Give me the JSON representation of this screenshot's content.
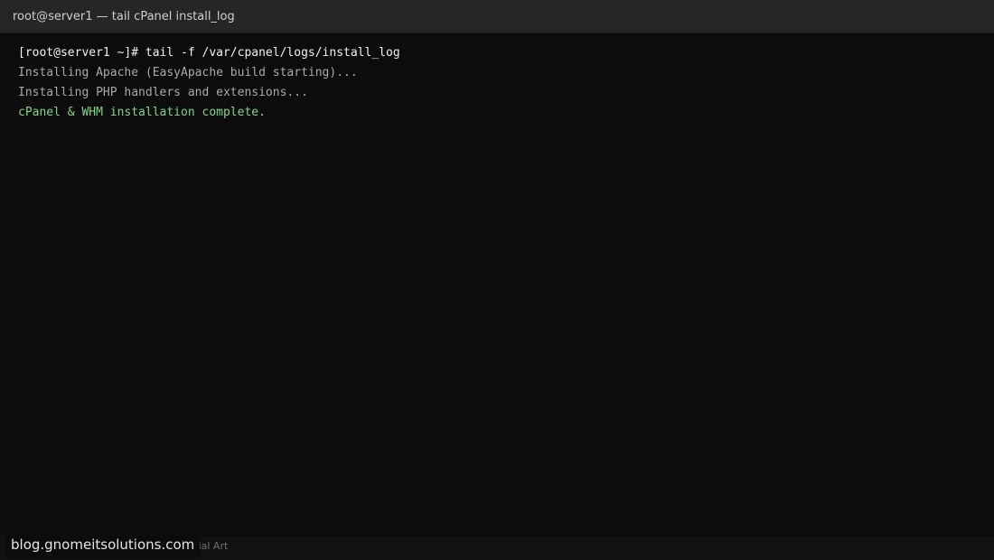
{
  "window": {
    "title": "root@server1 — tail cPanel install_log"
  },
  "terminal": {
    "lines": [
      {
        "kind": "prompt",
        "text": "[root@server1 ~]# tail -f /var/cpanel/logs/install_log"
      },
      {
        "kind": "output",
        "text": "Installing Apache (EasyApache build starting)..."
      },
      {
        "kind": "output",
        "text": "Installing PHP handlers and extensions..."
      },
      {
        "kind": "success",
        "text": "cPanel & WHM installation complete."
      }
    ]
  },
  "footer": {
    "caption": "Tutorial Art",
    "watermark": "blog.gnomeitsolutions.com"
  },
  "colors": {
    "background": "#0c0c0c",
    "titlebar": "#262626",
    "prompt_text": "#f2f2f2",
    "output_text": "#a9a9a9",
    "success_text": "#7fd68a"
  }
}
